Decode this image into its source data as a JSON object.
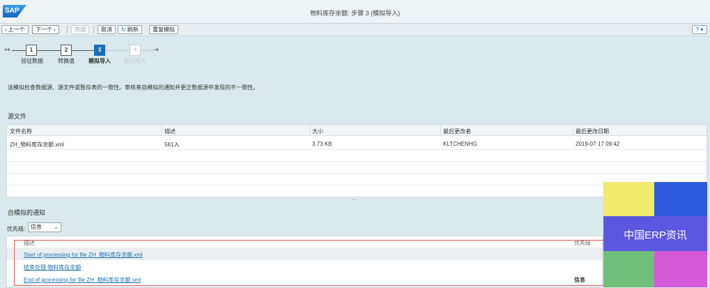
{
  "app": {
    "logo": "SAP",
    "title": "物料库存余额: 步骤 3 (模拟导入)"
  },
  "toolbar": {
    "prev": "上一个",
    "next": "下一个",
    "finish": "完成",
    "cancel": "取消",
    "refresh": "刷新",
    "resimulate": "重复模拟",
    "help": "?"
  },
  "steps": [
    {
      "num": "1",
      "label": "验证数据",
      "state": "done"
    },
    {
      "num": "2",
      "label": "转换值",
      "state": "done"
    },
    {
      "num": "3",
      "label": "模拟导入",
      "state": "active"
    },
    {
      "num": "4",
      "label": "执行导入",
      "state": "future"
    }
  ],
  "instruction": "该模拟检查数据源、源文件或暂存表的一致性。审核来自模拟的通知并更正数据源中发现的不一致性。",
  "source_file": {
    "title": "源文件",
    "columns": [
      "文件名称",
      "描述",
      "大小",
      "最后更改者",
      "最后更改日期"
    ],
    "rows": [
      [
        "ZH_物料库存余额.xml",
        "561入",
        "3.73 KB",
        "KLTCHENHG",
        "2019-07-17 09:42"
      ]
    ]
  },
  "notifications": {
    "title": "自模拟的通知",
    "priority_label": "优先级:",
    "priority_value": "信息",
    "columns": [
      "描述",
      "优先级"
    ],
    "rows": [
      {
        "text": "Start of processing for file ZH_物料库存余额.xml",
        "priority": ""
      },
      {
        "text": "结束处理 物料库存余额",
        "priority": ""
      },
      {
        "text": "End of processing for file ZH_物料库存余额.xml",
        "priority": "信息"
      }
    ]
  },
  "watermark": {
    "text": "中国ERP资讯",
    "colors": [
      "#f2ea6c",
      "#2f5be0",
      "#5c56e0",
      "#6fbf7a",
      "#d45ad8"
    ]
  },
  "resizer": "...."
}
